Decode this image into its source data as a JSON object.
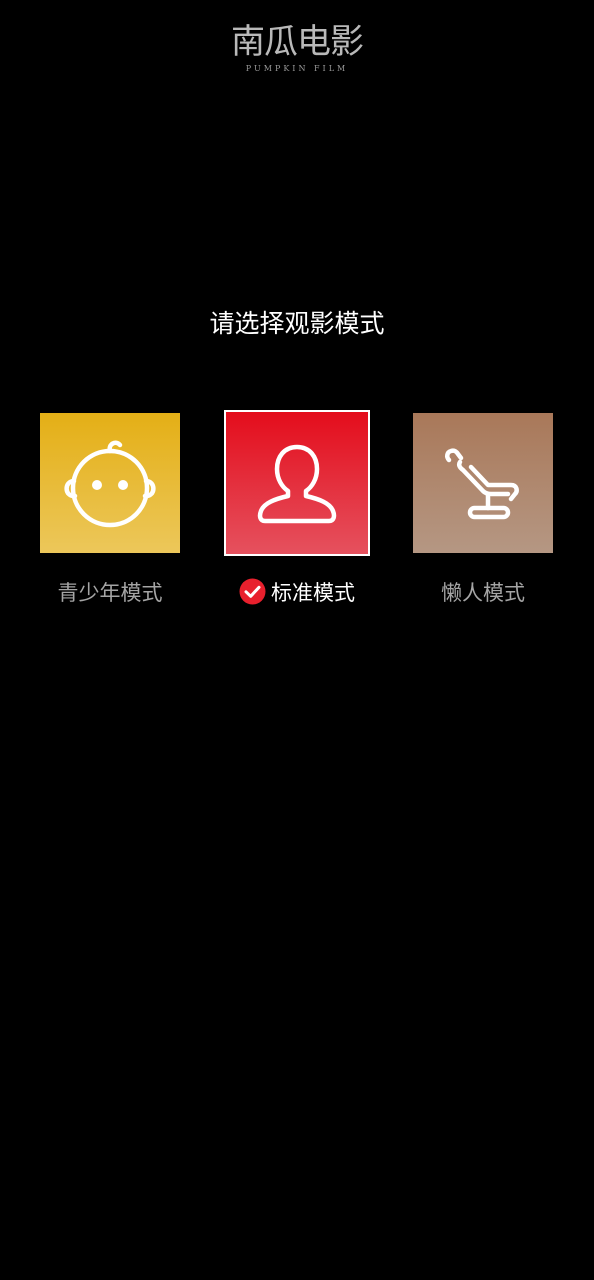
{
  "brand": {
    "name": "南瓜电影",
    "tagline": "PUMPKIN FILM"
  },
  "prompt": "请选择观影模式",
  "modes": [
    {
      "label": "青少年模式",
      "icon": "baby-face-icon",
      "gradient": [
        "#e4af16",
        "#ecc75a"
      ],
      "selected": false
    },
    {
      "label": "标准模式",
      "icon": "person-icon",
      "gradient": [
        "#e40d1c",
        "#e5515e"
      ],
      "selected": true
    },
    {
      "label": "懒人模式",
      "icon": "recliner-chair-icon",
      "gradient": [
        "#a97859",
        "#b59783"
      ],
      "selected": false
    }
  ],
  "selected_check_color": "#e8202d"
}
